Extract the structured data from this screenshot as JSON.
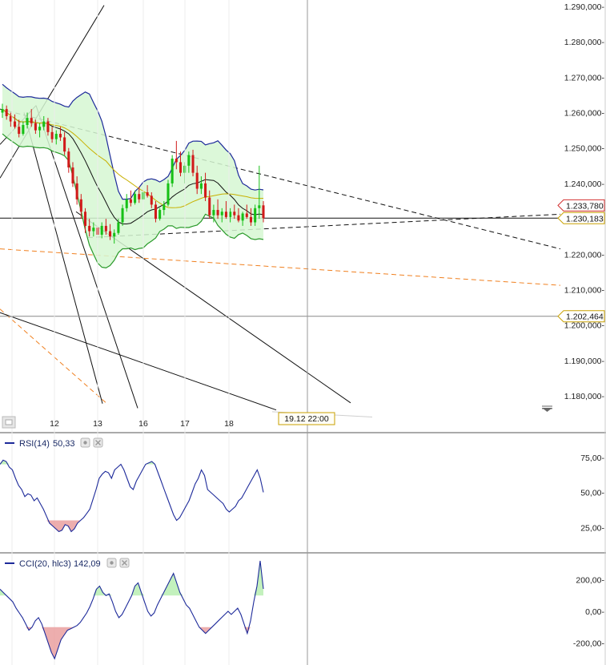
{
  "chart_data": [
    {
      "type": "candlestick",
      "x_ticks": [
        "12",
        "13",
        "16",
        "17",
        "18"
      ],
      "y_ticks": [
        "1.290,000-",
        "1.280,000-",
        "1.270,000-",
        "1.260,000-",
        "1.250,000-",
        "1.240,000-",
        "1.230,000-",
        "1.220,000-",
        "1.210,000-",
        "1.200,000-",
        "1.190,000-",
        "1.180,000-"
      ],
      "ylim": [
        1.172,
        1.292
      ],
      "price_tags": [
        {
          "label": "1.233,780",
          "value": 1.23378,
          "color": "#d23030"
        },
        {
          "label": "1.230,183",
          "value": 1.230183,
          "color": "#c8a000"
        },
        {
          "label": "1.202,464",
          "value": 1.202464,
          "color": "#c8a000"
        }
      ],
      "cursor_label": "19.12 22:00",
      "overlays": [
        "Bollinger Bands",
        "moving averages",
        "trend lines"
      ],
      "colors": {
        "up": "#16c016",
        "down": "#d11a1a",
        "band": "#1d2a9a",
        "band_fill": "#d6f7d2",
        "fib": "#f08020"
      },
      "candles": [
        [
          1.26,
          1.2625,
          1.2585,
          1.261
        ],
        [
          1.261,
          1.262,
          1.258,
          1.259
        ],
        [
          1.259,
          1.26,
          1.256,
          1.2575
        ],
        [
          1.2575,
          1.2595,
          1.2555,
          1.256
        ],
        [
          1.256,
          1.258,
          1.253,
          1.254
        ],
        [
          1.254,
          1.2575,
          1.2535,
          1.2565
        ],
        [
          1.2565,
          1.26,
          1.2555,
          1.2585
        ],
        [
          1.2585,
          1.261,
          1.256,
          1.257
        ],
        [
          1.257,
          1.258,
          1.254,
          1.255
        ],
        [
          1.255,
          1.257,
          1.253,
          1.256
        ],
        [
          1.256,
          1.259,
          1.255,
          1.2575
        ],
        [
          1.2575,
          1.2585,
          1.2535,
          1.2545
        ],
        [
          1.2545,
          1.256,
          1.2515,
          1.2525
        ],
        [
          1.2525,
          1.255,
          1.251,
          1.254
        ],
        [
          1.254,
          1.256,
          1.252,
          1.253
        ],
        [
          1.253,
          1.2545,
          1.248,
          1.249
        ],
        [
          1.249,
          1.25,
          1.243,
          1.2445
        ],
        [
          1.2445,
          1.246,
          1.239,
          1.24
        ],
        [
          1.24,
          1.242,
          1.234,
          1.2355
        ],
        [
          1.2355,
          1.237,
          1.23,
          1.232
        ],
        [
          1.232,
          1.233,
          1.226,
          1.228
        ],
        [
          1.228,
          1.23,
          1.225,
          1.2265
        ],
        [
          1.2265,
          1.229,
          1.225,
          1.2275
        ],
        [
          1.2275,
          1.2285,
          1.2245,
          1.2255
        ],
        [
          1.2255,
          1.229,
          1.2245,
          1.228
        ],
        [
          1.228,
          1.23,
          1.2255,
          1.2265
        ],
        [
          1.2265,
          1.2285,
          1.224,
          1.225
        ],
        [
          1.225,
          1.227,
          1.223,
          1.226
        ],
        [
          1.226,
          1.23,
          1.2255,
          1.229
        ],
        [
          1.229,
          1.234,
          1.228,
          1.233
        ],
        [
          1.233,
          1.237,
          1.232,
          1.2355
        ],
        [
          1.2355,
          1.238,
          1.2335,
          1.2345
        ],
        [
          1.2345,
          1.238,
          1.234,
          1.237
        ],
        [
          1.237,
          1.239,
          1.2345,
          1.2355
        ],
        [
          1.2355,
          1.2385,
          1.235,
          1.2375
        ],
        [
          1.2375,
          1.2395,
          1.236,
          1.2365
        ],
        [
          1.2365,
          1.2375,
          1.233,
          1.234
        ],
        [
          1.234,
          1.235,
          1.229,
          1.23
        ],
        [
          1.23,
          1.233,
          1.2295,
          1.2325
        ],
        [
          1.2325,
          1.235,
          1.231,
          1.234
        ],
        [
          1.234,
          1.241,
          1.2335,
          1.24
        ],
        [
          1.24,
          1.248,
          1.239,
          1.247
        ],
        [
          1.247,
          1.252,
          1.244,
          1.246
        ],
        [
          1.246,
          1.249,
          1.242,
          1.243
        ],
        [
          1.243,
          1.246,
          1.24,
          1.245
        ],
        [
          1.245,
          1.249,
          1.243,
          1.248
        ],
        [
          1.248,
          1.2495,
          1.242,
          1.243
        ],
        [
          1.243,
          1.245,
          1.237,
          1.2385
        ],
        [
          1.2385,
          1.242,
          1.237,
          1.24
        ],
        [
          1.24,
          1.243,
          1.235,
          1.236
        ],
        [
          1.236,
          1.238,
          1.23,
          1.231
        ],
        [
          1.231,
          1.234,
          1.229,
          1.2325
        ],
        [
          1.2325,
          1.2355,
          1.23,
          1.231
        ],
        [
          1.231,
          1.233,
          1.229,
          1.232
        ],
        [
          1.232,
          1.235,
          1.23,
          1.2305
        ],
        [
          1.2305,
          1.233,
          1.229,
          1.232
        ],
        [
          1.232,
          1.234,
          1.23,
          1.231
        ],
        [
          1.231,
          1.233,
          1.229,
          1.2295
        ],
        [
          1.2295,
          1.232,
          1.228,
          1.2315
        ],
        [
          1.2315,
          1.234,
          1.23,
          1.2305
        ],
        [
          1.2305,
          1.233,
          1.228,
          1.229
        ],
        [
          1.229,
          1.234,
          1.228,
          1.233
        ],
        [
          1.233,
          1.245,
          1.23,
          1.2338
        ],
        [
          1.2338,
          1.235,
          1.229,
          1.2302
        ]
      ]
    },
    {
      "type": "line",
      "indicator_label": "RSI(14)",
      "indicator_value": "50,33",
      "y_ticks": [
        "75,00-",
        "50,00-",
        "25,00-"
      ],
      "ylim": [
        8,
        88
      ],
      "overbought": 70,
      "oversold": 30,
      "values": [
        70,
        73,
        72,
        68,
        66,
        60,
        55,
        52,
        47,
        49,
        48,
        44,
        46,
        42,
        38,
        33,
        28,
        26,
        24,
        22,
        23,
        27,
        26,
        22,
        24,
        28,
        30,
        32,
        35,
        38,
        45,
        52,
        60,
        63,
        65,
        64,
        60,
        66,
        68,
        70,
        66,
        60,
        54,
        52,
        58,
        62,
        66,
        70,
        71,
        72,
        70,
        64,
        58,
        52,
        46,
        40,
        34,
        30,
        32,
        36,
        40,
        44,
        50,
        56,
        60,
        66,
        62,
        52,
        50,
        48,
        46,
        44,
        42,
        38,
        36,
        38,
        40,
        44,
        46,
        50,
        54,
        58,
        62,
        66,
        60,
        50
      ]
    },
    {
      "type": "line",
      "indicator_label": "CCI(20, hlc3)",
      "indicator_value": "142,09",
      "y_ticks": [
        "200,00-",
        "0,00-",
        "-200,00-"
      ],
      "ylim": [
        -330,
        330
      ],
      "overbought": 100,
      "oversold": -100,
      "values": [
        140,
        120,
        100,
        80,
        60,
        20,
        -10,
        -40,
        -80,
        -120,
        -100,
        -60,
        -40,
        -80,
        -140,
        -200,
        -260,
        -300,
        -240,
        -180,
        -150,
        -120,
        -110,
        -100,
        -90,
        -70,
        -40,
        -10,
        30,
        80,
        140,
        160,
        120,
        100,
        110,
        60,
        0,
        -40,
        -20,
        20,
        60,
        100,
        160,
        180,
        120,
        60,
        0,
        -30,
        -10,
        40,
        80,
        120,
        160,
        200,
        240,
        180,
        120,
        80,
        40,
        20,
        -20,
        -60,
        -100,
        -120,
        -140,
        -120,
        -100,
        -80,
        -60,
        -40,
        -20,
        0,
        -20,
        0,
        20,
        -20,
        -80,
        -140,
        -60,
        60,
        160,
        320,
        142
      ]
    }
  ]
}
